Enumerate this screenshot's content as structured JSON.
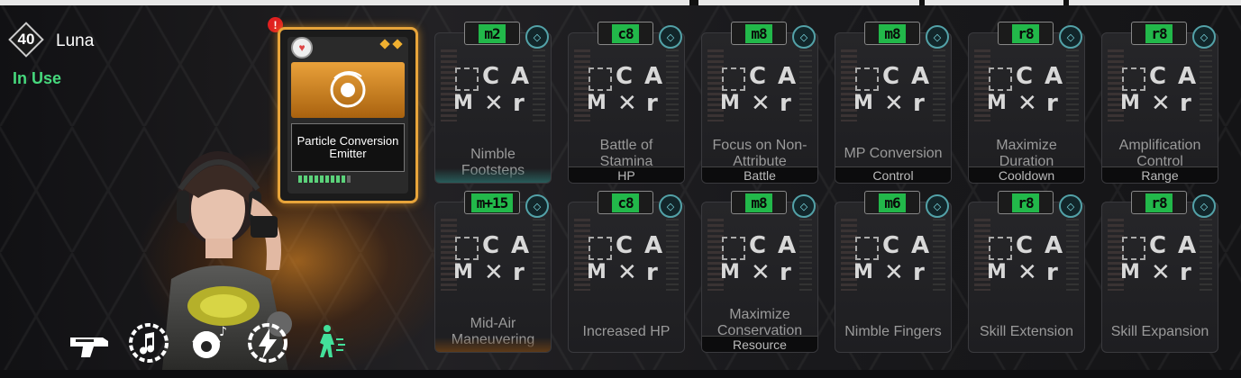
{
  "character": {
    "level": "40",
    "name": "Luna",
    "status": "In Use",
    "skills": [
      "gun-icon",
      "music-burst-icon",
      "headphone-icon",
      "lightning-ring-icon",
      "dance-icon"
    ]
  },
  "equipped_module": {
    "name": "Particle Conversion Emitter",
    "alert": "!",
    "capacity_filled": 9,
    "capacity_total": 10
  },
  "modules": [
    {
      "cost": "m2",
      "name": "Nimble Footsteps",
      "tag": "",
      "accent": "teal"
    },
    {
      "cost": "c8",
      "name": "Battle of Stamina",
      "tag": "HP",
      "accent": ""
    },
    {
      "cost": "m8",
      "name": "Focus on Non-Attribute",
      "tag": "Battle",
      "accent": ""
    },
    {
      "cost": "m8",
      "name": "MP Conversion",
      "tag": "Control",
      "accent": ""
    },
    {
      "cost": "r8",
      "name": "Maximize Duration",
      "tag": "Cooldown",
      "accent": ""
    },
    {
      "cost": "r8",
      "name": "Amplification Control",
      "tag": "Range",
      "accent": ""
    },
    {
      "cost": "m+15",
      "name": "Mid-Air Maneuvering",
      "tag": "",
      "accent": "orange"
    },
    {
      "cost": "c8",
      "name": "Increased HP",
      "tag": "",
      "accent": ""
    },
    {
      "cost": "m8",
      "name": "Maximize Conservation",
      "tag": "Resource",
      "accent": ""
    },
    {
      "cost": "m6",
      "name": "Nimble Fingers",
      "tag": "",
      "accent": ""
    },
    {
      "cost": "r8",
      "name": "Skill Extension",
      "tag": "",
      "accent": ""
    },
    {
      "cost": "r8",
      "name": "Skill Expansion",
      "tag": "",
      "accent": ""
    }
  ],
  "colors": {
    "status_green": "#46d97d",
    "cost_green": "#22b84a",
    "equipped_gold": "#e7a43a",
    "type_teal": "#53a2a8"
  }
}
